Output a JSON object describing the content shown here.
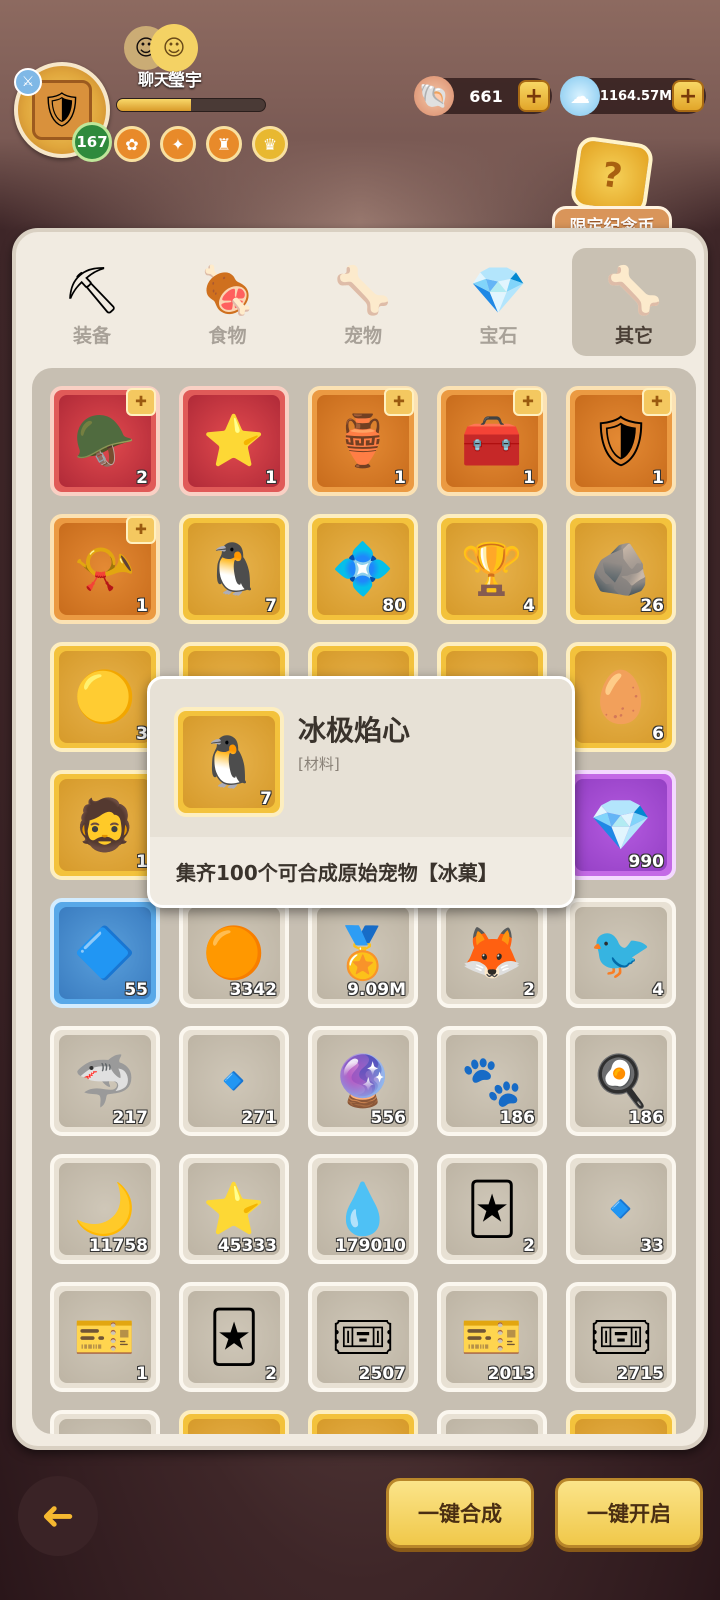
{
  "player": {
    "name": "瑩宇",
    "level": "167",
    "chat_label": "聊天",
    "xp_fraction": 0.5
  },
  "currencies": [
    {
      "name": "shell",
      "icon": "🐚",
      "value": "661"
    },
    {
      "name": "crystal-cloud",
      "icon": "☁",
      "value": "1164.57M"
    }
  ],
  "limited": {
    "label": "限定纪念币",
    "icon": "?"
  },
  "tabs": [
    {
      "label": "装备",
      "icon": "⛏"
    },
    {
      "label": "食物",
      "icon": "🍖"
    },
    {
      "label": "宠物",
      "icon": "🦴"
    },
    {
      "label": "宝石",
      "icon": "💎"
    },
    {
      "label": "其它",
      "icon": "🦴",
      "active": true
    }
  ],
  "items": [
    {
      "rarity": "r-red",
      "icon": "🪖",
      "count": "2",
      "puzzle": true
    },
    {
      "rarity": "r-red",
      "icon": "⭐",
      "count": "1"
    },
    {
      "rarity": "r-orange",
      "icon": "🏺",
      "count": "1",
      "puzzle": true
    },
    {
      "rarity": "r-orange",
      "icon": "🧰",
      "count": "1",
      "puzzle": true
    },
    {
      "rarity": "r-orange",
      "icon": "🛡",
      "count": "1",
      "puzzle": true
    },
    {
      "rarity": "r-orange",
      "icon": "📯",
      "count": "1",
      "puzzle": true
    },
    {
      "rarity": "r-gold",
      "icon": "🐧",
      "count": "7"
    },
    {
      "rarity": "r-gold",
      "icon": "💠",
      "count": "80"
    },
    {
      "rarity": "r-gold",
      "icon": "🏆",
      "count": "4"
    },
    {
      "rarity": "r-gold",
      "icon": "🪨",
      "count": "26"
    },
    {
      "rarity": "r-gold",
      "icon": "🟡",
      "count": "3"
    },
    {
      "rarity": "r-gold",
      "icon": "",
      "count": ""
    },
    {
      "rarity": "r-gold",
      "icon": "",
      "count": ""
    },
    {
      "rarity": "r-gold",
      "icon": "",
      "count": ""
    },
    {
      "rarity": "r-gold",
      "icon": "🥚",
      "count": "6"
    },
    {
      "rarity": "r-gold",
      "icon": "🧔",
      "count": "1"
    },
    {
      "rarity": "r-gold",
      "icon": "",
      "count": ""
    },
    {
      "rarity": "r-gold",
      "icon": "",
      "count": ""
    },
    {
      "rarity": "r-gold",
      "icon": "",
      "count": ""
    },
    {
      "rarity": "r-purple",
      "icon": "💎",
      "count": "990"
    },
    {
      "rarity": "r-blue",
      "icon": "🔷",
      "count": "55"
    },
    {
      "rarity": "r-white",
      "icon": "🟠",
      "count": "3342"
    },
    {
      "rarity": "r-white",
      "icon": "🏅",
      "count": "9.09M"
    },
    {
      "rarity": "r-white",
      "icon": "🦊",
      "count": "2"
    },
    {
      "rarity": "r-white",
      "icon": "🐦",
      "count": "4"
    },
    {
      "rarity": "r-white",
      "icon": "🦈",
      "count": "217"
    },
    {
      "rarity": "r-white",
      "icon": "🔹",
      "count": "271"
    },
    {
      "rarity": "r-white",
      "icon": "🔮",
      "count": "556"
    },
    {
      "rarity": "r-white",
      "icon": "🐾",
      "count": "186"
    },
    {
      "rarity": "r-white",
      "icon": "🍳",
      "count": "186"
    },
    {
      "rarity": "r-white",
      "icon": "🌙",
      "count": "11758"
    },
    {
      "rarity": "r-white",
      "icon": "⭐",
      "count": "45333"
    },
    {
      "rarity": "r-white",
      "icon": "💧",
      "count": "179010"
    },
    {
      "rarity": "r-white",
      "icon": "🃏",
      "count": "2"
    },
    {
      "rarity": "r-white",
      "icon": "🔹",
      "count": "33"
    },
    {
      "rarity": "r-white",
      "icon": "🎫",
      "count": "1"
    },
    {
      "rarity": "r-white",
      "icon": "🃏",
      "count": "2"
    },
    {
      "rarity": "r-white",
      "icon": "🎟",
      "count": "2507"
    },
    {
      "rarity": "r-white",
      "icon": "🎫",
      "count": "2013"
    },
    {
      "rarity": "r-white",
      "icon": "🎟",
      "count": "2715"
    },
    {
      "rarity": "r-white",
      "icon": "",
      "count": ""
    },
    {
      "rarity": "r-gold",
      "icon": "",
      "count": ""
    },
    {
      "rarity": "r-gold",
      "icon": "",
      "count": ""
    },
    {
      "rarity": "r-white",
      "icon": "",
      "count": ""
    },
    {
      "rarity": "r-gold",
      "icon": "",
      "count": ""
    }
  ],
  "tooltip": {
    "name": "冰极焰心",
    "type": "[材料]",
    "count": "7",
    "icon": "🐧",
    "description": "集齐100个可合成原始宠物【冰菓】"
  },
  "buttons": {
    "merge": "一键合成",
    "open": "一键开启",
    "back_icon": "➜"
  }
}
